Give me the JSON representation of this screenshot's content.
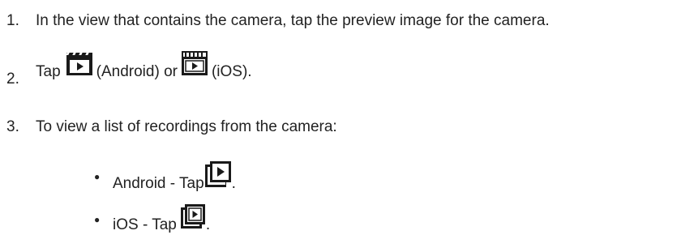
{
  "steps": [
    {
      "number": "1.",
      "text": "In the view that contains the camera, tap the preview image for the camera."
    },
    {
      "number": "2.",
      "prefix": "Tap",
      "android_label": "(Android) or",
      "ios_label": "(iOS).",
      "android_icon": "clapperboard-android-icon",
      "ios_icon": "clapperboard-ios-icon"
    },
    {
      "number": "3.",
      "text": "To view a list of recordings from the camera:",
      "bullets": [
        {
          "text": "Android - Tap",
          "suffix": ".",
          "icon": "recordings-list-android-icon"
        },
        {
          "text": "iOS - Tap",
          "suffix": ".",
          "icon": "recordings-list-ios-icon"
        }
      ]
    }
  ],
  "colors": {
    "text": "#222222",
    "icon": "#1a1a1a"
  }
}
